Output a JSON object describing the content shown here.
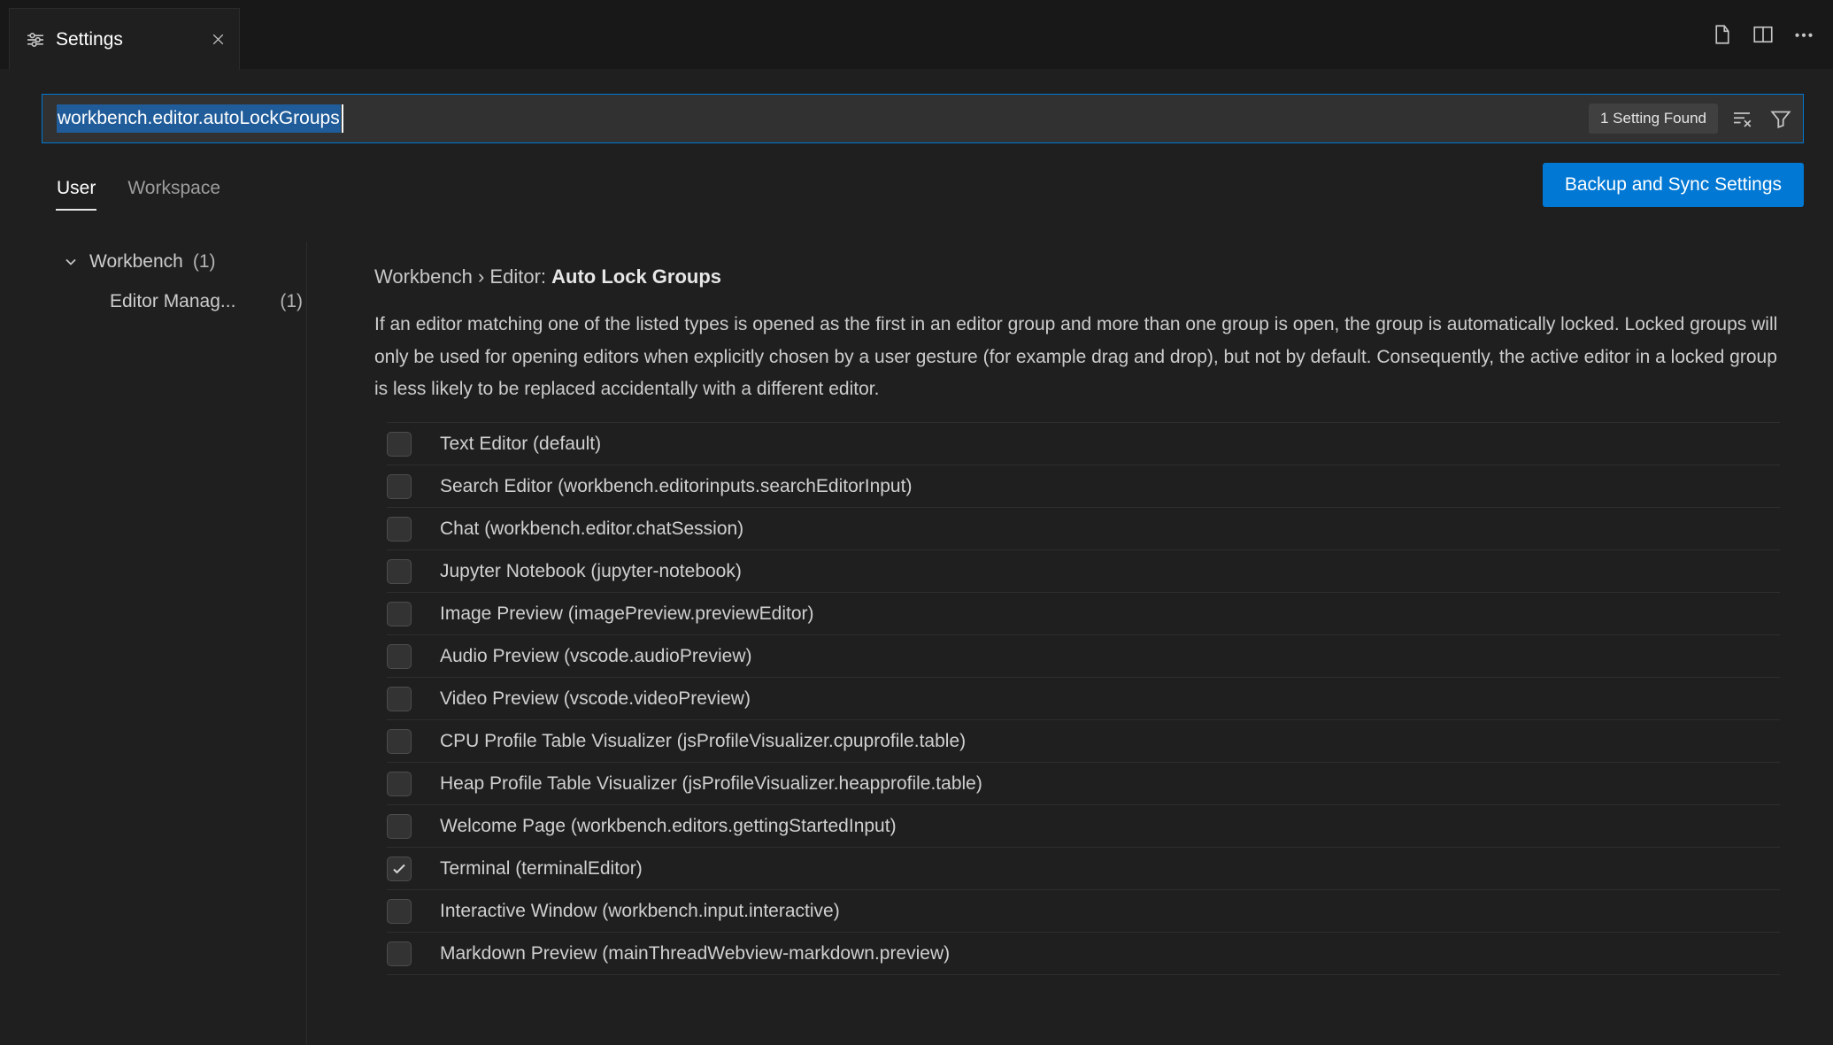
{
  "colors": {
    "accent": "#0078d4",
    "selection": "#1f5c99",
    "badge_bg": "#404040",
    "tabbar_bg": "#181818",
    "editor_bg": "#1f1f1f",
    "text": "#cccccc",
    "text_dim": "#9d9d9d"
  },
  "tab": {
    "title": "Settings"
  },
  "icons": {
    "tab": "settings-sliders-icon",
    "tab_close": "close-icon",
    "editor_actions": [
      "open-settings-json-icon",
      "split-editor-icon",
      "more-actions-icon"
    ],
    "search": [
      "clear-search-icon",
      "filter-icon"
    ],
    "toc": "chevron-down-icon",
    "checkbox_checked": "check-icon"
  },
  "search": {
    "value": "workbench.editor.autoLockGroups",
    "badge": "1 Setting Found"
  },
  "scope_tabs": [
    {
      "label": "User",
      "active": true
    },
    {
      "label": "Workspace",
      "active": false
    }
  ],
  "backup_button": "Backup and Sync Settings",
  "toc": [
    {
      "label": "Workbench",
      "count": "(1)",
      "expanded": true
    },
    {
      "label": "Editor Manag...",
      "count": "(1)"
    }
  ],
  "setting": {
    "category": "Workbench › Editor: ",
    "name": "Auto Lock Groups",
    "description": "If an editor matching one of the listed types is opened as the first in an editor group and more than one group is open, the group is automatically locked. Locked groups will only be used for opening editors when explicitly chosen by a user gesture (for example drag and drop), but not by default. Consequently, the active editor in a locked group is less likely to be replaced accidentally with a different editor.",
    "options": [
      {
        "label": "Text Editor (default)",
        "checked": false
      },
      {
        "label": "Search Editor (workbench.editorinputs.searchEditorInput)",
        "checked": false
      },
      {
        "label": "Chat (workbench.editor.chatSession)",
        "checked": false
      },
      {
        "label": "Jupyter Notebook (jupyter-notebook)",
        "checked": false
      },
      {
        "label": "Image Preview (imagePreview.previewEditor)",
        "checked": false
      },
      {
        "label": "Audio Preview (vscode.audioPreview)",
        "checked": false
      },
      {
        "label": "Video Preview (vscode.videoPreview)",
        "checked": false
      },
      {
        "label": "CPU Profile Table Visualizer (jsProfileVisualizer.cpuprofile.table)",
        "checked": false
      },
      {
        "label": "Heap Profile Table Visualizer (jsProfileVisualizer.heapprofile.table)",
        "checked": false
      },
      {
        "label": "Welcome Page (workbench.editors.gettingStartedInput)",
        "checked": false
      },
      {
        "label": "Terminal (terminalEditor)",
        "checked": true
      },
      {
        "label": "Interactive Window (workbench.input.interactive)",
        "checked": false
      },
      {
        "label": "Markdown Preview (mainThreadWebview-markdown.preview)",
        "checked": false
      }
    ]
  }
}
